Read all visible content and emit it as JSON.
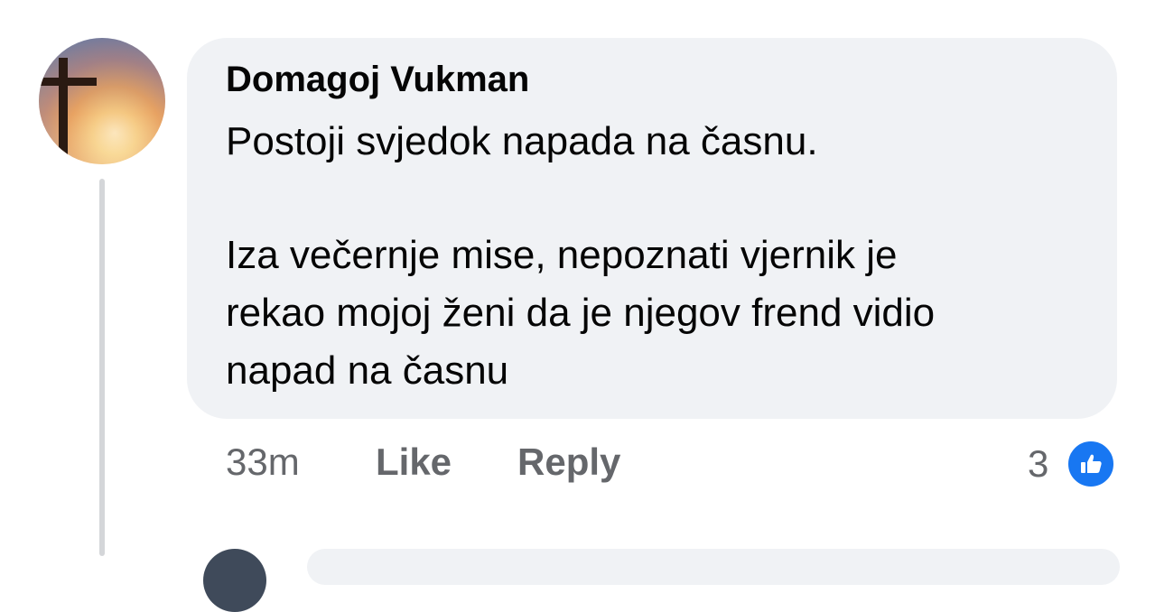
{
  "comment": {
    "author": "Domagoj Vukman",
    "lines": [
      "Postoji svjedok napada na časnu.",
      "Iza večernje mise, nepoznati vjernik je",
      "rekao mojoj ženi da je njegov frend vidio",
      "napad na časnu"
    ],
    "timestamp": "33m",
    "like_label": "Like",
    "reply_label": "Reply",
    "reaction_count": "3"
  },
  "avatar": {
    "icon": "cross-sunset-icon"
  },
  "colors": {
    "bubble": "#f0f2f5",
    "text": "#050505",
    "meta": "#65676b",
    "like_blue": "#1877f2"
  }
}
